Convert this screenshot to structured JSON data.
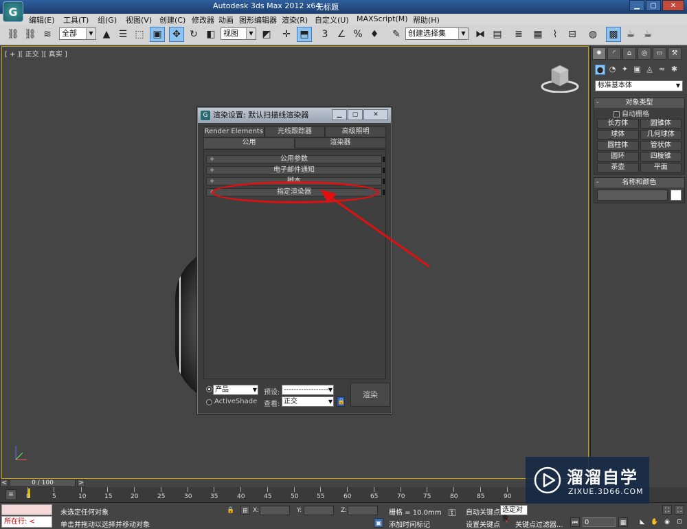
{
  "window": {
    "app_title": "Autodesk 3ds Max  2012 x64",
    "doc_title": "无标题"
  },
  "menu": [
    "编辑(E)",
    "工具(T)",
    "组(G)",
    "视图(V)",
    "创建(C)",
    "修改器",
    "动画",
    "图形编辑器",
    "渲染(R)",
    "自定义(U)",
    "MAXScript(M)",
    "帮助(H)"
  ],
  "toolbar": {
    "selection_filter": "全部",
    "ref_coord": "视图",
    "named_selection": "创建选择集"
  },
  "viewport": {
    "label": "[ + ][ 正交 ][ 真实 ]"
  },
  "command_panel": {
    "category": "标准基本体",
    "object_type_title": "对象类型",
    "autogrid_label": "自动栅格",
    "objects": [
      "长方体",
      "圆锥体",
      "球体",
      "几何球体",
      "圆柱体",
      "管状体",
      "圆环",
      "四棱锥",
      "茶壶",
      "平面"
    ],
    "name_color_title": "名称和颜色"
  },
  "dialog": {
    "title": "渲染设置: 默认扫描线渲染器",
    "tabs_row1": [
      "Render Elements",
      "光线跟踪器",
      "高级照明"
    ],
    "tabs_row2": [
      "公用",
      "渲染器"
    ],
    "rollouts": [
      "公用参数",
      "电子邮件通知",
      "脚本",
      "指定渲染器"
    ],
    "mode_product": "产品",
    "mode_activeshade": "ActiveShade",
    "preset_label": "预设:",
    "preset_value": "--------------------",
    "view_label": "查看:",
    "view_value": "正交",
    "render_button": "渲染"
  },
  "timeline": {
    "slider": "0 / 100",
    "ticks": [
      "0",
      "5",
      "10",
      "15",
      "20",
      "25",
      "30",
      "35",
      "40",
      "45",
      "50",
      "55",
      "60",
      "65",
      "70",
      "75",
      "80",
      "85",
      "90"
    ]
  },
  "status": {
    "listener": "所在行:",
    "line1": "未选定任何对象",
    "line2": "单击并拖动以选择并移动对象",
    "x_label": "X:",
    "y_label": "Y:",
    "z_label": "Z:",
    "grid": "栅格 = 10.0mm",
    "add_time_tag": "添加时间标记",
    "auto_key": "自动关键点",
    "auto_key_sel": "选定对象",
    "set_key": "设置关键点",
    "key_filters": "关键点过滤器...",
    "frame": "0"
  },
  "watermark": {
    "title": "溜溜自学",
    "subtitle": "ZIXUE.3D66.COM"
  },
  "colors": {
    "accent_red": "#e01010",
    "viewport_border": "#c8a000",
    "active_tool": "#8ec3ef"
  }
}
